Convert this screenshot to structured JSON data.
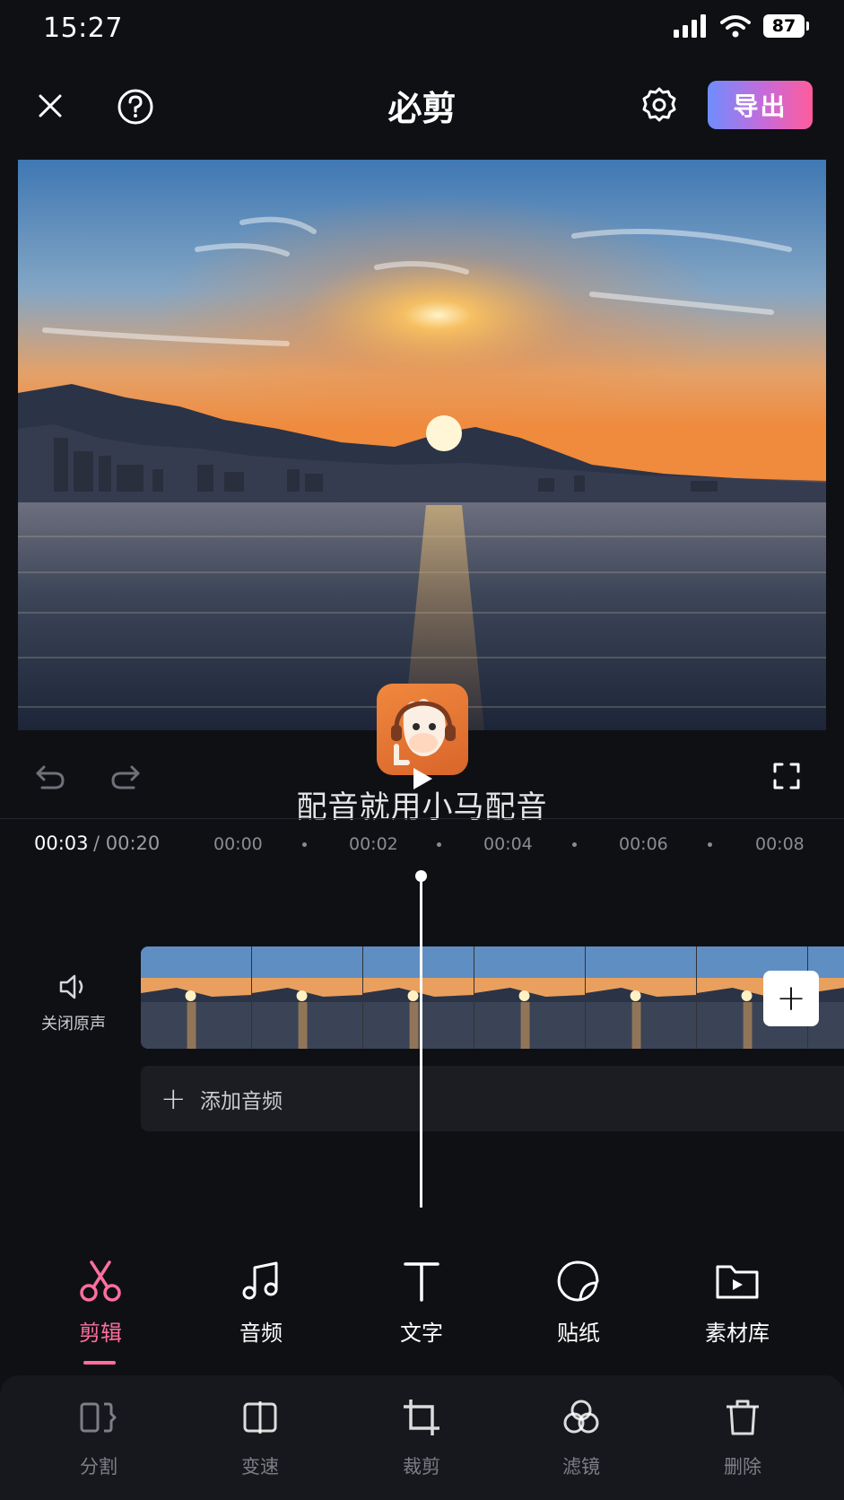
{
  "status_bar": {
    "time": "15:27",
    "battery": "87",
    "icons": [
      "signal-icon",
      "wifi-icon",
      "battery-icon"
    ]
  },
  "header": {
    "title": "必剪",
    "close_icon": "close-icon",
    "help_icon": "help-icon",
    "settings_icon": "gear-icon",
    "export_label": "导出"
  },
  "preview": {
    "watermark_text": "配音就用小马配音",
    "controls": [
      "undo-icon",
      "redo-icon",
      "play-icon",
      "fullscreen-icon"
    ]
  },
  "timeline": {
    "current_time": "00:03",
    "total_time": "/ 00:20",
    "ticks": [
      "00:00",
      "00:02",
      "00:04",
      "00:06",
      "00:08"
    ],
    "mute_label": "关闭原声",
    "add_audio_label": "添加音频",
    "playhead_progress": 0.15
  },
  "bottom_tabs": [
    {
      "label": "剪辑",
      "icon": "scissors-icon",
      "active": true
    },
    {
      "label": "音频",
      "icon": "music-note-icon",
      "active": false
    },
    {
      "label": "文字",
      "icon": "text-icon",
      "active": false
    },
    {
      "label": "贴纸",
      "icon": "sticker-icon",
      "active": false
    },
    {
      "label": "素材库",
      "icon": "folder-play-icon",
      "active": false
    }
  ],
  "tools": [
    {
      "label": "分割",
      "icon": "split-icon"
    },
    {
      "label": "变速",
      "icon": "speed-icon"
    },
    {
      "label": "裁剪",
      "icon": "crop-icon"
    },
    {
      "label": "滤镜",
      "icon": "filter-icon"
    },
    {
      "label": "删除",
      "icon": "trash-icon"
    }
  ],
  "colors": {
    "accent": "#ff6f9e",
    "background": "#0f1014",
    "export_gradient": [
      "#6f8dff",
      "#ff5c9a"
    ]
  }
}
